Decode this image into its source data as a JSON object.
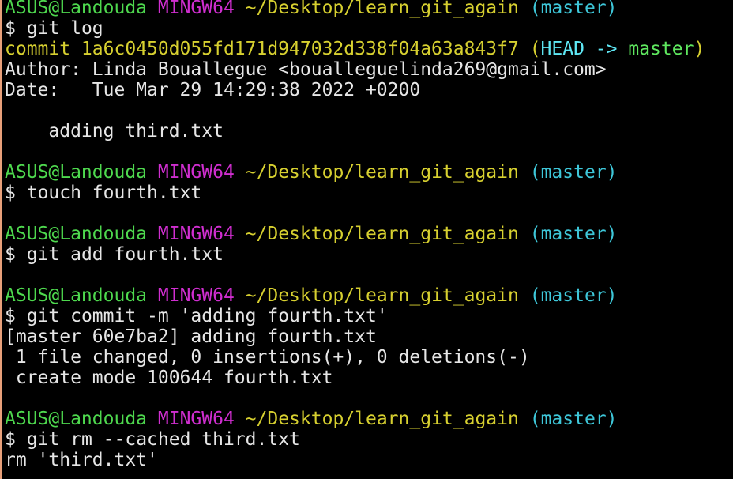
{
  "prompt": {
    "user_host": "ASUS@Landouda",
    "system": "MINGW64",
    "path": "~/Desktop/learn_git_again",
    "branch": "(master)",
    "symbol": "$"
  },
  "commands": [
    "git log",
    "touch fourth.txt",
    "git add fourth.txt",
    "git commit -m 'adding fourth.txt'",
    "git rm --cached third.txt"
  ],
  "log": {
    "commit_label": "commit 1a6c0450d055fd171d947032d338f04a63a843f7",
    "ref_open": "(",
    "ref_head": "HEAD ->",
    "ref_branch": "master",
    "ref_close": ")",
    "author": "Author: Linda Bouallegue <bouallegue​linda269@gmail.com>",
    "date": "Date:   Tue Mar 29 14:29:38 2022 +0200",
    "message": "    adding third.txt"
  },
  "commit_output": [
    "[master 60e7ba2] adding fourth.txt",
    " 1 file changed, 0 insertions(+), 0 deletions(-)",
    " create mode 100644 fourth.txt"
  ],
  "rm_output": "rm 'third.txt'",
  "colors": {
    "background": "#000000",
    "user_host": "#4ed84e",
    "system": "#d02ed0",
    "path": "#d7d030",
    "branch": "#3ec7d9",
    "text": "#e6e6e6"
  }
}
